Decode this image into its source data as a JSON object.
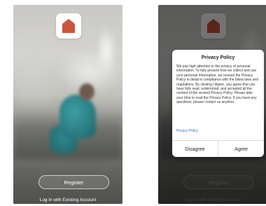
{
  "colors": {
    "brand": "#c9553a",
    "link": "#2a6fd6"
  },
  "welcome_screen": {
    "logo_icon": "house-icon",
    "register_label": "Register",
    "login_link": "Log in with Existing Account"
  },
  "privacy_dialog": {
    "title": "Privacy Policy",
    "body": "We pay high attention to the privacy of personal information. To fully present how we collect and use your personal information, we revised the Privacy Policy in detail in compliance with the latest laws and regulations. By clicking I Agree, you agree that you have fully read, understood, and accepted all the content of the revised Privacy Policy. Please take your time to read the Privacy Policy. If you have any questions, please contact us anytime.",
    "policy_link": "Privacy Policy",
    "disagree_label": "Disagree",
    "agree_label": "Agree"
  }
}
